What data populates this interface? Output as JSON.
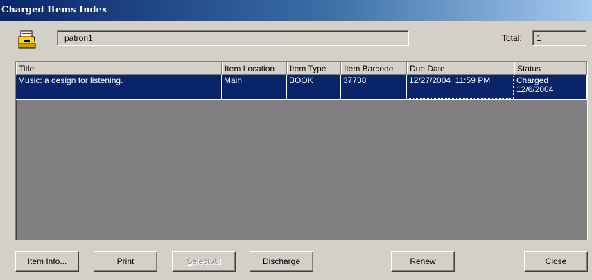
{
  "window": {
    "title": "Charged Items Index"
  },
  "patron": {
    "icon": "card-file-box-icon",
    "value": "patron1"
  },
  "total": {
    "label": "Total:",
    "value": "1"
  },
  "grid": {
    "columns": [
      "Title",
      "Item Location",
      "Item Type",
      "Item Barcode",
      "Due Date",
      "Status"
    ],
    "rows": [
      {
        "title": "Music: a design for listening.",
        "location": "Main",
        "type": "BOOK",
        "barcode": "37738",
        "due_date": "12/27/2004  11:59 PM",
        "status_line1": "Charged",
        "status_line2": "12/6/2004",
        "selected": true
      }
    ]
  },
  "buttons": {
    "item_info": {
      "accel": "I",
      "rest": "tem Info..."
    },
    "print": {
      "pre": "P",
      "accel": "r",
      "rest": "int"
    },
    "select_all": {
      "accel": "S",
      "rest": "elect All",
      "enabled": false
    },
    "discharge": {
      "accel": "D",
      "rest": "ischarge"
    },
    "renew": {
      "accel": "R",
      "rest": "enew"
    },
    "close": {
      "accel": "C",
      "rest": "lose"
    }
  },
  "colors": {
    "selection": "#0a246a",
    "face": "#d4d0c8",
    "grid_bg": "#808080"
  }
}
